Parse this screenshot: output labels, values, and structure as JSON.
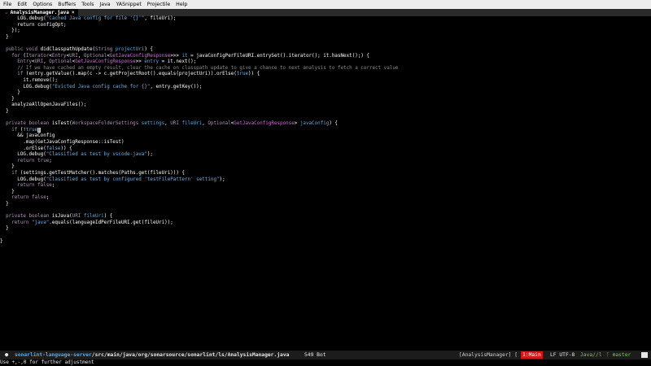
{
  "menu": {
    "items": [
      "File",
      "Edit",
      "Options",
      "Buffers",
      "Tools",
      "Java",
      "YASnippet",
      "Projectile",
      "Help"
    ]
  },
  "tab": {
    "icon": "java-file-icon",
    "title": "AnalysisManager.java",
    "close": "×"
  },
  "code": {
    "lines": [
      [
        [
          "      LOG.debug(",
          ""
        ],
        [
          "\"Cached Java config for file '{}'\"",
          "st"
        ],
        [
          ", fileUri);",
          ""
        ]
      ],
      [
        [
          "      return configOpt;",
          ""
        ]
      ],
      [
        [
          "    });",
          ""
        ]
      ],
      [
        [
          "  }",
          ""
        ]
      ],
      [
        [
          "",
          ""
        ]
      ],
      [
        [
          "  ",
          ""
        ],
        [
          "public void",
          "kw"
        ],
        [
          " didClasspathUpdate(",
          ""
        ],
        [
          "String",
          "ty"
        ],
        [
          " ",
          ""
        ],
        [
          "projectUri",
          "pa"
        ],
        [
          ") {",
          ""
        ]
      ],
      [
        [
          "    ",
          ""
        ],
        [
          "for",
          "kw"
        ],
        [
          " (",
          ""
        ],
        [
          "Iterator",
          "ty"
        ],
        [
          "<",
          ""
        ],
        [
          "Entry",
          "ty"
        ],
        [
          "<",
          ""
        ],
        [
          "URI",
          "ty"
        ],
        [
          ", ",
          ""
        ],
        [
          "Optional",
          "ty"
        ],
        [
          "<",
          ""
        ],
        [
          "GetJavaConfigResponse",
          "ty2"
        ],
        [
          ">>> ",
          ""
        ],
        [
          "it",
          "pa"
        ],
        [
          " = javaConfigPerFileURI.entrySet().iterator(); it.hasNext();) {",
          ""
        ]
      ],
      [
        [
          "      ",
          ""
        ],
        [
          "Entry",
          "ty"
        ],
        [
          "<",
          ""
        ],
        [
          "URI",
          "ty"
        ],
        [
          ", ",
          ""
        ],
        [
          "Optional",
          "ty"
        ],
        [
          "<",
          ""
        ],
        [
          "GetJavaConfigResponse",
          "ty2"
        ],
        [
          ">> ",
          ""
        ],
        [
          "entry",
          "pa"
        ],
        [
          " = it.next();",
          ""
        ]
      ],
      [
        [
          "      ",
          ""
        ],
        [
          "// If we have cached an empty result, clear the cache on classpath update to give a chance to next analysis to fetch a correct value",
          "cm"
        ]
      ],
      [
        [
          "      ",
          ""
        ],
        [
          "if",
          "kw"
        ],
        [
          " (entry.getValue().map(c -> c.getProjectRoot().equals(projectUri)).orElse(",
          ""
        ],
        [
          "true",
          "lit"
        ],
        [
          ")) {",
          ""
        ]
      ],
      [
        [
          "        it.remove();",
          ""
        ]
      ],
      [
        [
          "        LOG.debug(",
          ""
        ],
        [
          "\"Evicted Java config cache for {}\"",
          "st"
        ],
        [
          ", entry.getKey());",
          ""
        ]
      ],
      [
        [
          "      }",
          ""
        ]
      ],
      [
        [
          "    }",
          ""
        ]
      ],
      [
        [
          "    analyzeAllOpenJavaFiles();",
          ""
        ]
      ],
      [
        [
          "  }",
          ""
        ]
      ],
      [
        [
          "",
          ""
        ]
      ],
      [
        [
          "  ",
          ""
        ],
        [
          "private boolean",
          "kw"
        ],
        [
          " isTest(",
          ""
        ],
        [
          "WorkspaceFolderSettings",
          "ty"
        ],
        [
          " ",
          ""
        ],
        [
          "settings",
          "pa"
        ],
        [
          ", ",
          ""
        ],
        [
          "URI",
          "ty"
        ],
        [
          " ",
          ""
        ],
        [
          "fileUri",
          "pa"
        ],
        [
          ", ",
          ""
        ],
        [
          "Optional",
          "ty"
        ],
        [
          "<",
          ""
        ],
        [
          "GetJavaConfigResponse",
          "ty2"
        ],
        [
          "> ",
          ""
        ],
        [
          "javaConfig",
          "pa"
        ],
        [
          ") {",
          ""
        ]
      ],
      [
        [
          "    ",
          ""
        ],
        [
          "if",
          "kw"
        ],
        [
          " (!",
          ""
        ],
        [
          "true",
          "lit"
        ],
        [
          "|",
          "cursor"
        ]
      ],
      [
        [
          "      && javaConfig",
          ""
        ]
      ],
      [
        [
          "        .map(GetJavaConfigResponse::isTest)",
          ""
        ]
      ],
      [
        [
          "        .orElse(",
          ""
        ],
        [
          "false",
          "lit"
        ],
        [
          ")) {",
          ""
        ]
      ],
      [
        [
          "      LOG.debug(",
          ""
        ],
        [
          "\"Classified as test by vscode-java\"",
          "st"
        ],
        [
          ");",
          ""
        ]
      ],
      [
        [
          "      ",
          ""
        ],
        [
          "return true",
          "kw"
        ],
        [
          ";",
          ""
        ]
      ],
      [
        [
          "    }",
          ""
        ]
      ],
      [
        [
          "    ",
          ""
        ],
        [
          "if",
          "kw"
        ],
        [
          " (settings.getTestMatcher().matches(Paths.get(fileUri))) {",
          ""
        ]
      ],
      [
        [
          "      LOG.debug(",
          ""
        ],
        [
          "\"Classified as test by configured 'testFilePattern' setting\"",
          "st"
        ],
        [
          ");",
          ""
        ]
      ],
      [
        [
          "      ",
          ""
        ],
        [
          "return false",
          "kw"
        ],
        [
          ";",
          ""
        ]
      ],
      [
        [
          "    }",
          ""
        ]
      ],
      [
        [
          "    ",
          ""
        ],
        [
          "return false",
          "kw"
        ],
        [
          ";",
          ""
        ]
      ],
      [
        [
          "  }",
          ""
        ]
      ],
      [
        [
          "",
          ""
        ]
      ],
      [
        [
          "  ",
          ""
        ],
        [
          "private boolean",
          "kw"
        ],
        [
          " isJava(",
          ""
        ],
        [
          "URI",
          "ty"
        ],
        [
          " ",
          ""
        ],
        [
          "fileUri",
          "pa"
        ],
        [
          ") {",
          ""
        ]
      ],
      [
        [
          "    ",
          ""
        ],
        [
          "return",
          "kw"
        ],
        [
          " ",
          ""
        ],
        [
          "\"java\"",
          "st"
        ],
        [
          ".equals(languageIdPerFileURI.get(fileUri));",
          ""
        ]
      ],
      [
        [
          "  }",
          ""
        ]
      ],
      [
        [
          "",
          ""
        ]
      ],
      [
        [
          "}",
          ""
        ]
      ]
    ]
  },
  "modeline": {
    "dot": "●",
    "project": "sonarlint-language-server",
    "path": "/src/main/java/org/sonarsource/sonarlint/ls/AnalysisManager.java",
    "position": "549 Bot",
    "function": "[AnalysisManager] [",
    "branch_box": "1:Main",
    "encoding": "LF UTF-8",
    "mode": "Java//l",
    "git": "ᚴ master",
    "colors": {
      "project": "#5fa8e0",
      "branch": "#d01818",
      "mode": "#78c850"
    }
  },
  "echo_area": {
    "message": "Use +,-,0 for further adjustment"
  }
}
